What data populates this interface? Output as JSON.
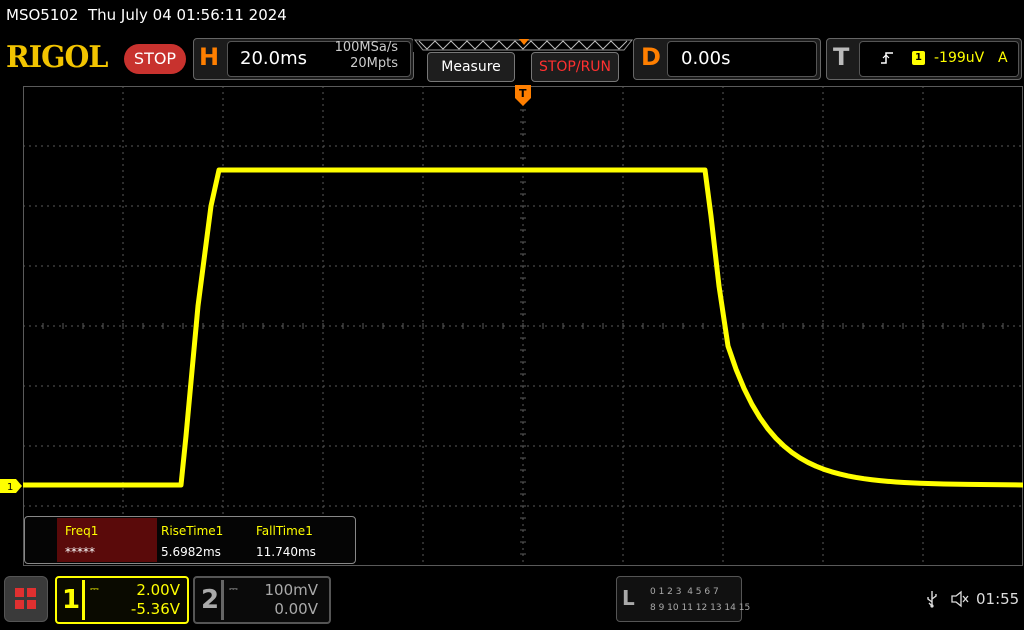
{
  "title_bar": {
    "text": "MSO5102  Thu July 04 01:56:11 2024"
  },
  "brand": {
    "logo": "RIGOL",
    "run_state": "STOP"
  },
  "horizontal": {
    "letter": "H",
    "timebase": "20.0ms",
    "sample_rate": "100MSa/s",
    "memory_depth": "20Mpts"
  },
  "toolbar": {
    "measure_label": "Measure",
    "stop_run_label": "STOP/RUN"
  },
  "delay": {
    "letter": "D",
    "value": "0.00s"
  },
  "trigger": {
    "letter": "T",
    "edge_icon": "rising-edge-icon",
    "source": "1",
    "level": "-199uV",
    "mode": "A"
  },
  "screen": {
    "channel1_marker": "1",
    "trace_color": "#ffff00",
    "grid_color": "#5a5a5a"
  },
  "measurements": {
    "items": [
      {
        "label": "Freq1",
        "value": "*****"
      },
      {
        "label": "RiseTime1",
        "value": "5.6982ms"
      },
      {
        "label": "FallTime1",
        "value": "11.740ms"
      }
    ]
  },
  "channels": {
    "ch1": {
      "number": "1",
      "scale": "2.00V",
      "offset": "-5.36V",
      "color": "#ffff00"
    },
    "ch2": {
      "number": "2",
      "scale": "100mV",
      "offset": "0.00V",
      "color": "#aaaaaa"
    }
  },
  "logic": {
    "letter": "L",
    "row1": "0 1 2 3  4 5 6 7",
    "row2": "8 9 10 11 12 13 14 15"
  },
  "status": {
    "usb_icon": "usb-icon",
    "speaker_icon": "speaker-muted-icon",
    "clock": "01:55"
  },
  "accent": {
    "brand": "#f2c400",
    "stop": "#c8322e",
    "orange": "#ff7f00"
  }
}
